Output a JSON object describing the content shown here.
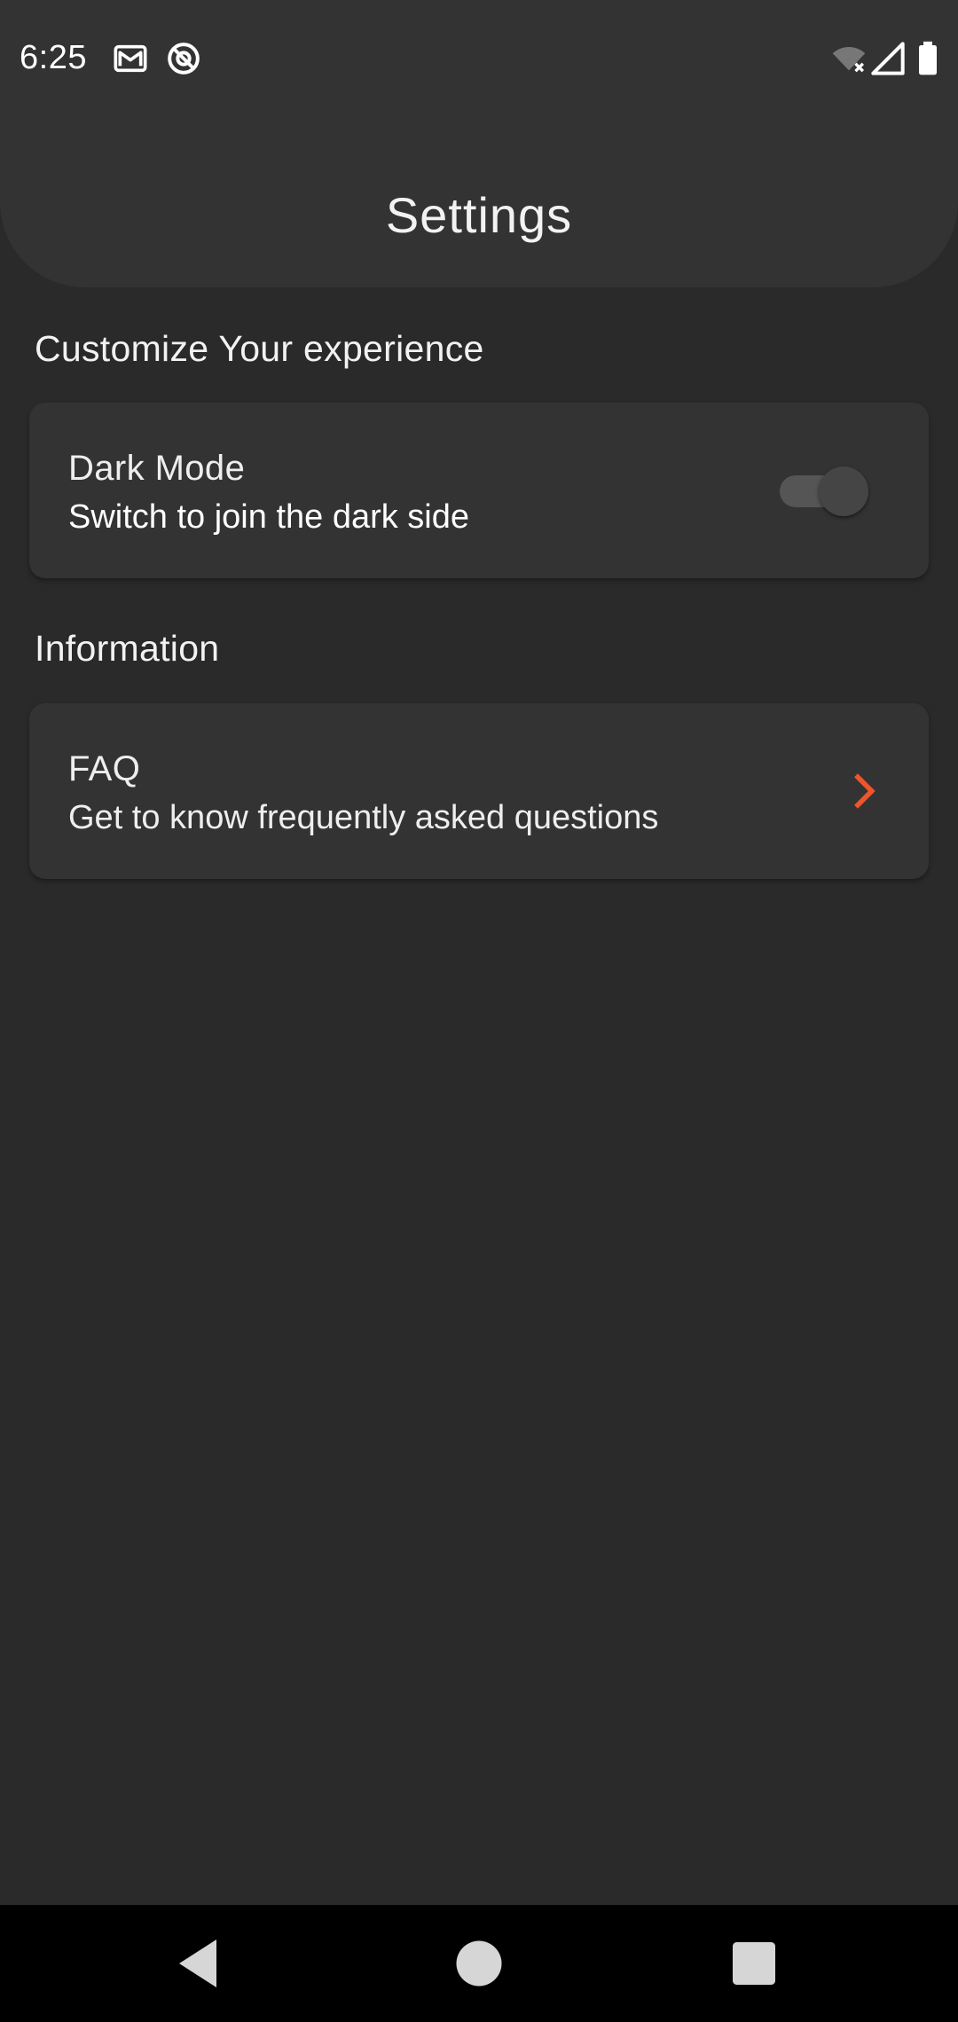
{
  "status_bar": {
    "time": "6:25",
    "icons": [
      "gmail-icon",
      "at-sign-icon",
      "wifi-off-icon",
      "signal-icon",
      "battery-icon"
    ]
  },
  "app_bar": {
    "title": "Settings"
  },
  "sections": [
    {
      "header": "Customize Your experience",
      "item": {
        "title": "Dark Mode",
        "subtitle": "Switch to join the dark side",
        "toggle_on": true
      }
    },
    {
      "header": "Information",
      "item": {
        "title": "FAQ",
        "subtitle": "Get to know frequently asked questions",
        "trailing_icon": "chevron-right-icon"
      }
    }
  ],
  "nav_bar": {
    "buttons": [
      "back-icon",
      "home-icon",
      "recents-icon"
    ]
  },
  "colors": {
    "background": "#2a2a2a",
    "surface": "#333333",
    "accent": "#f0542a",
    "text": "#ffffff"
  }
}
